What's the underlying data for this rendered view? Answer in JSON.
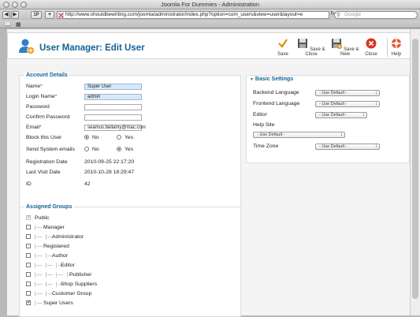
{
  "window": {
    "title": "Joomla For Dummies - Administration"
  },
  "browser": {
    "url": "http://www.shouldbewriting.com/joomla/administrator/index.php?option=com_users&view=user&layout=e",
    "search_placeholder": "Google",
    "back_label": "◀",
    "forward_label": "▶",
    "add_label": "+",
    "reload_label": "↻",
    "reader_label": "1P"
  },
  "header": {
    "title": "User Manager: Edit User",
    "buttons": {
      "save": "Save",
      "save_close": "Save & Close",
      "save_new": "Save & New",
      "close": "Close",
      "help": "Help"
    }
  },
  "account": {
    "legend": "Account Details",
    "name_label": "Name",
    "name_value": "Super User",
    "login_label": "Login Name",
    "login_value": "admin",
    "password_label": "Password",
    "confirm_label": "Confirm Password",
    "email_label": "Email",
    "email_value": "seamus.bellamy@mac.com",
    "block_label": "Block this User",
    "send_label": "Send System emails",
    "no": "No",
    "yes": "Yes",
    "registration_label": "Registration Date",
    "registration_value": "2010-09-25 22:17:20",
    "lastvisit_label": "Last Visit Date",
    "lastvisit_value": "2010-10-28 18:29:47",
    "id_label": "ID",
    "id_value": "42",
    "required_mark": "*"
  },
  "basic": {
    "legend": "Basic Settings",
    "toggle": "▼",
    "backend_label": "Backend Language",
    "frontend_label": "Frontend Language",
    "editor_label": "Editor",
    "helpsite_label": "Help Site",
    "timezone_label": "Time Zone",
    "use_default": "- Use Default -"
  },
  "groups": {
    "legend": "Assigned Groups",
    "items": [
      {
        "label": "Public",
        "prefix": "",
        "checked": true,
        "disabled": true
      },
      {
        "label": "Manager",
        "prefix": "|—",
        "checked": false
      },
      {
        "label": "Administrator",
        "prefix": "|— |—",
        "checked": false
      },
      {
        "label": "Registered",
        "prefix": "|—",
        "checked": false
      },
      {
        "label": "Author",
        "prefix": "|— |—",
        "checked": false
      },
      {
        "label": "Editor",
        "prefix": "|— |— |—",
        "checked": false
      },
      {
        "label": "Publisher",
        "prefix": "|— |— |— |—",
        "checked": false
      },
      {
        "label": "Shop Suppliers",
        "prefix": "|— |— |—",
        "checked": false
      },
      {
        "label": "Customer Group",
        "prefix": "|— |—",
        "checked": false
      },
      {
        "label": "Super Users",
        "prefix": "|—",
        "checked": true
      }
    ]
  },
  "colors": {
    "accent": "#146295",
    "close": "#d9331f",
    "save": "#e08b00"
  }
}
